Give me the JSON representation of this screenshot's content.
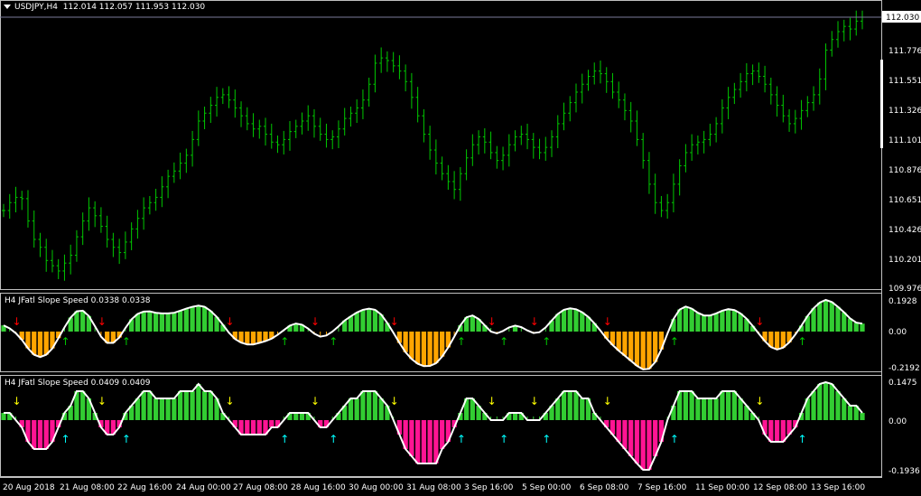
{
  "header": {
    "symbol": "USDJPY,H4",
    "ohlc": "112.014 112.057 111.953 112.030"
  },
  "price_axis": {
    "labels": [
      "112.030",
      "111.776",
      "111.551",
      "111.326",
      "111.101",
      "110.876",
      "110.651",
      "110.426",
      "110.201",
      "109.976"
    ],
    "current": "112.030"
  },
  "indicator1": {
    "title": "H4 JFatl Slope Speed 0.0338 0.0338",
    "axis_labels": [
      "0.1928",
      "0.00",
      "-0.2192"
    ]
  },
  "indicator2": {
    "title": "H4 JFatl Slope Speed 0.0409 0.0409",
    "axis_labels": [
      "0.1475",
      "0.00",
      "-0.1936"
    ]
  },
  "time_axis": {
    "labels": [
      "20 Aug 2018",
      "21 Aug 08:00",
      "22 Aug 16:00",
      "24 Aug 00:00",
      "27 Aug 08:00",
      "28 Aug 16:00",
      "30 Aug 00:00",
      "31 Aug 08:00",
      "3 Sep 16:00",
      "5 Sep 00:00",
      "6 Sep 08:00",
      "7 Sep 16:00",
      "11 Sep 00:00",
      "12 Sep 08:00",
      "13 Sep 16:00"
    ]
  },
  "colors": {
    "background": "#000000",
    "bars": "#00c800",
    "green_hist": "#32cd32",
    "orange_hist": "#ffa500",
    "magenta_hist": "#ff1493",
    "line": "#ffffff",
    "arrow_red": "#ff0000",
    "arrow_green": "#00c800",
    "arrow_yellow": "#ffff00",
    "arrow_cyan": "#00ffff"
  },
  "chart_data": {
    "type": "ohlc",
    "series": [
      {
        "name": "USDJPY,H4",
        "close": [
          110.56,
          110.62,
          110.66,
          110.65,
          110.48,
          110.34,
          110.28,
          110.18,
          110.14,
          110.1,
          110.16,
          110.22,
          110.36,
          110.48,
          110.58,
          110.52,
          110.44,
          110.34,
          110.28,
          110.24,
          110.32,
          110.42,
          110.5,
          110.58,
          110.62,
          110.66,
          110.74,
          110.82,
          110.86,
          110.92,
          110.98,
          111.1,
          111.24,
          111.3,
          111.36,
          111.42,
          111.44,
          111.4,
          111.34,
          111.28,
          111.22,
          111.18,
          111.2,
          111.14,
          111.08,
          111.06,
          111.1,
          111.16,
          111.2,
          111.24,
          111.28,
          111.2,
          111.14,
          111.1,
          111.12,
          111.18,
          111.26,
          111.3,
          111.34,
          111.4,
          111.52,
          111.68,
          111.72,
          111.7,
          111.66,
          111.62,
          111.54,
          111.42,
          111.28,
          111.14,
          111.02,
          110.92,
          110.84,
          110.78,
          110.72,
          110.84,
          110.96,
          111.06,
          111.12,
          111.08,
          111.0,
          110.94,
          110.98,
          111.06,
          111.12,
          111.14,
          111.1,
          111.04,
          111.0,
          111.04,
          111.12,
          111.22,
          111.3,
          111.38,
          111.46,
          111.52,
          111.58,
          111.62,
          111.6,
          111.54,
          111.46,
          111.4,
          111.32,
          111.24,
          111.1,
          110.94,
          110.76,
          110.62,
          110.56,
          110.62,
          110.76,
          110.9,
          111.0,
          111.06,
          111.08,
          111.1,
          111.14,
          111.22,
          111.34,
          111.42,
          111.48,
          111.54,
          111.6,
          111.62,
          111.58,
          111.52,
          111.44,
          111.36,
          111.28,
          111.22,
          111.26,
          111.32,
          111.38,
          111.44,
          111.56,
          111.78,
          111.86,
          111.92,
          111.96,
          111.94,
          112.0,
          112.03
        ]
      }
    ]
  }
}
